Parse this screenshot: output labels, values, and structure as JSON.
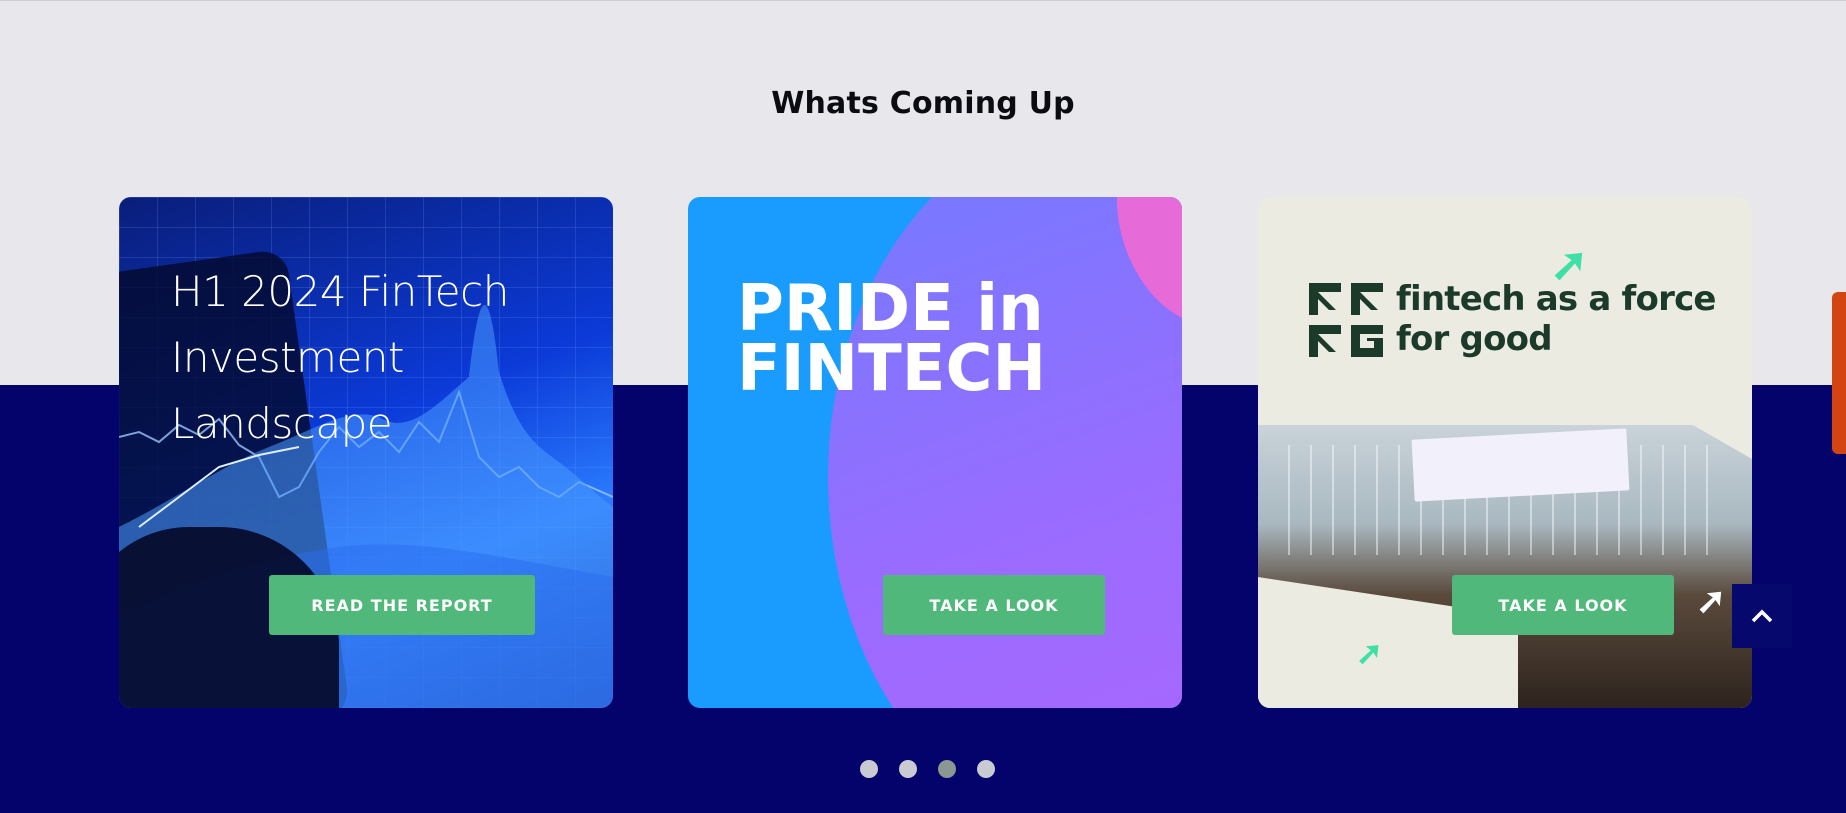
{
  "section": {
    "title": "Whats Coming Up"
  },
  "cards": [
    {
      "heading": "H1 2024 FinTech Investment Landscape",
      "button_label": "READ THE REPORT"
    },
    {
      "heading": "PRIDE in FINTECH",
      "button_label": "TAKE A LOOK"
    },
    {
      "heading": "fintech as a force for good",
      "button_label": "TAKE A LOOK"
    }
  ],
  "carousel": {
    "dot_count": 4,
    "active_index": 2
  },
  "colors": {
    "navy_band": "#03036b",
    "light_band": "#e8e7eb",
    "button_green": "#4fb87a",
    "side_tab_orange": "#d44312"
  },
  "icons": {
    "scroll_top": "chevron-up-icon"
  }
}
